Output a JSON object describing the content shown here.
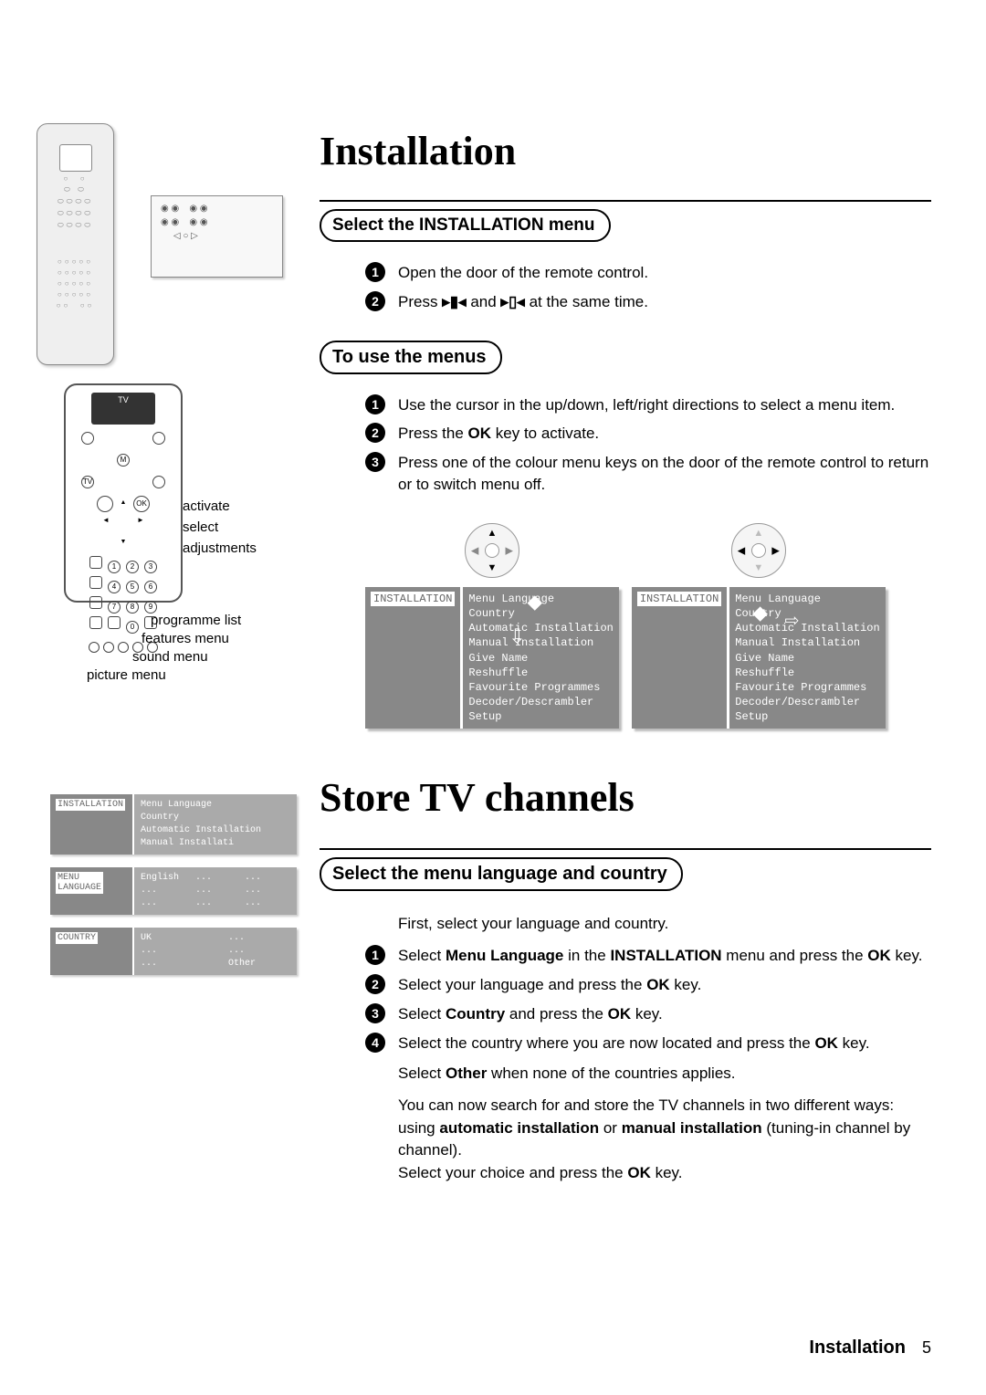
{
  "headings": {
    "installation": "Installation",
    "store": "Store TV channels"
  },
  "pills": {
    "select_install_menu": "Select the INSTALLATION menu",
    "to_use_menus": "To use the menus",
    "select_lang_country": "Select the menu language and country"
  },
  "installSteps": {
    "s1": "Open the door of the remote control.",
    "s2a": "Press ",
    "s2b": " and ",
    "s2c": " at the same time."
  },
  "menuSteps": {
    "s1": "Use the cursor in the up/down, left/right directions to select a menu item.",
    "s2a": "Press the ",
    "s2b": " key to activate.",
    "s3": "Press one of the colour menu keys on the door of the remote control to return or to switch menu off."
  },
  "menu": {
    "title": "INSTALLATION",
    "items": [
      "Menu Language",
      "Country",
      "Automatic Installation",
      "Manual Installation",
      "Give Name",
      "Reshuffle",
      "Favourite Programmes",
      "Decoder/Descrambler",
      "Setup"
    ]
  },
  "labels": {
    "activate": "activate",
    "select": "select",
    "adjustments": "adjustments",
    "programme_list": "programme list",
    "features_menu": "features menu",
    "sound_menu": "sound menu",
    "picture_menu": "picture menu"
  },
  "storeIntro": "First, select your language and country.",
  "storeSteps": {
    "s1a": "Select ",
    "s1b": "Menu Language",
    "s1c": " in the ",
    "s1d": "INSTALLATION",
    "s1e": " menu and press the ",
    "s1f": "OK",
    "s1g": " key.",
    "s2a": "Select your language and press the ",
    "s2b": "OK",
    "s2c": " key.",
    "s3a": "Select ",
    "s3b": "Country",
    "s3c": " and press the ",
    "s3d": "OK",
    "s3e": " key.",
    "s4a": "Select the country where you are now located and press the ",
    "s4b": "OK",
    "s4c": " key.",
    "p1a": "Select ",
    "p1b": "Other",
    "p1c": " when none of the countries applies.",
    "p2a": "You can now search for and store the TV channels in two different ways: using ",
    "p2b": "automatic installation",
    "p2c": " or ",
    "p2d": "manual installation",
    "p2e": " (tuning-in channel by channel).",
    "p3a": "Select your choice and press the ",
    "p3b": "OK",
    "p3c": " key."
  },
  "smallMenus": {
    "b1side": "INSTALLATION",
    "b1body": "Menu Language\nCountry\nAutomatic Installation\nManual Installati",
    "b2side": "MENU\nLANGUAGE",
    "b2body": "English   ...      ...\n...       ...      ...\n...       ...      ...",
    "b3side": "COUNTRY",
    "b3body": "UK              ...\n...             ...\n...             Other"
  },
  "footer": {
    "label": "Installation",
    "page": "5"
  },
  "ok": "OK",
  "tv": "TV"
}
